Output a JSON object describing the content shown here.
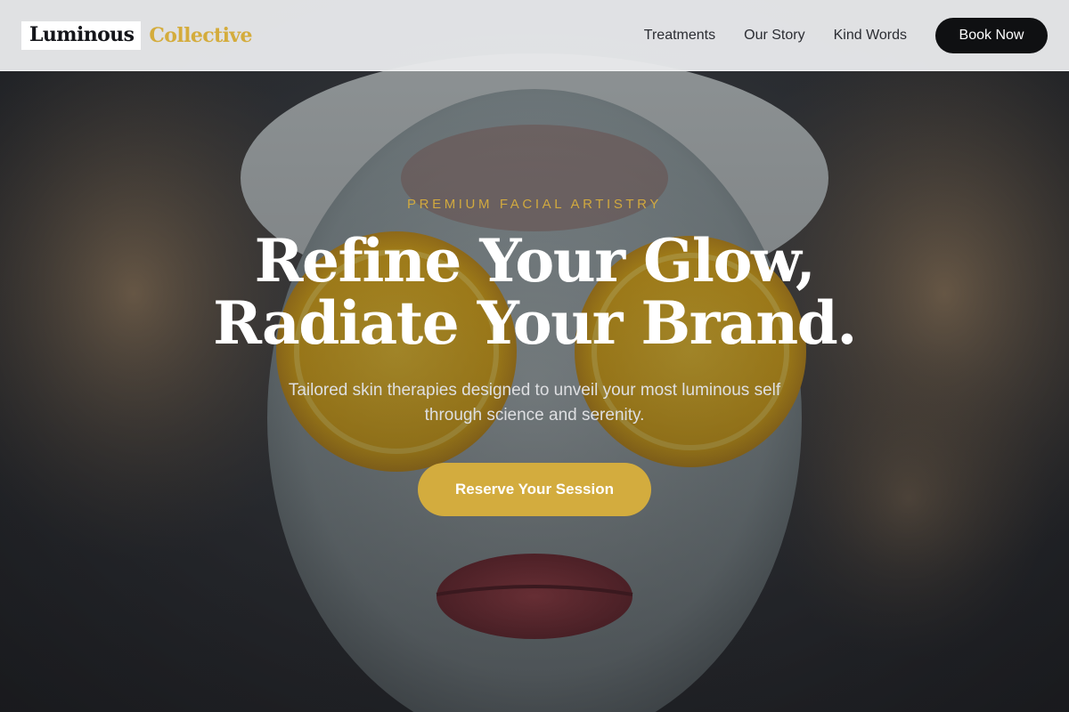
{
  "brand": {
    "name_primary": "Luminous",
    "name_accent": "Collective",
    "accent_color": "#d4ac3c"
  },
  "nav": {
    "items": [
      {
        "label": "Treatments"
      },
      {
        "label": "Our Story"
      },
      {
        "label": "Kind Words"
      }
    ],
    "cta_label": "Book Now"
  },
  "hero": {
    "eyebrow": "PREMIUM FACIAL ARTISTRY",
    "headline_line1": "Refine Your Glow,",
    "headline_line2": "Radiate Your Brand.",
    "subtext": "Tailored skin therapies designed to unveil your most luminous self through science and serenity.",
    "cta_label": "Reserve Your Session",
    "cta_color": "#d3ac3e"
  }
}
